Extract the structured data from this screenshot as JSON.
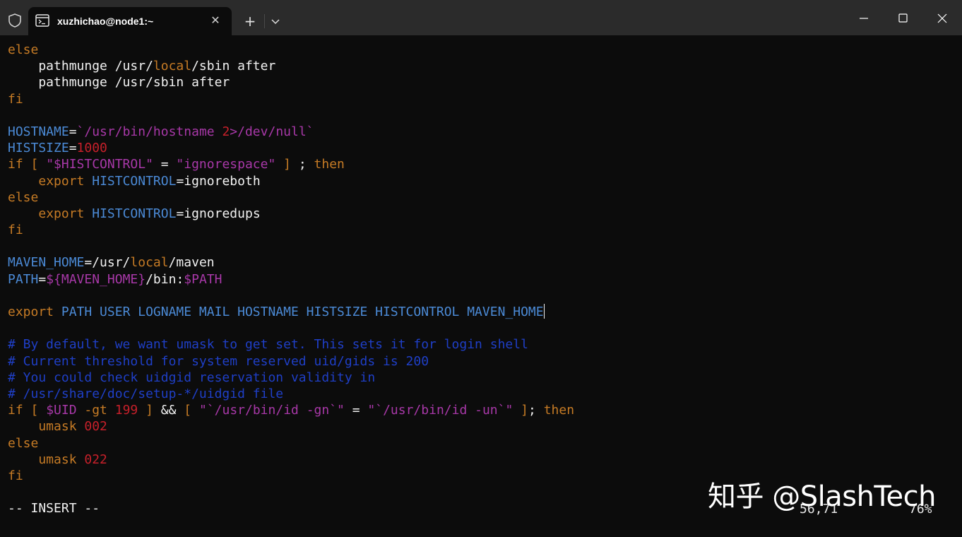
{
  "colors": {
    "keyword": "#c67b25",
    "variable": "#4b8ad6",
    "string": "#a838a8",
    "number": "#c7202a",
    "comment": "#1f3fc7",
    "plain": "#f2f2f2",
    "background": "#0c0c0c",
    "titlebar": "#2b2b2b"
  },
  "window": {
    "tab_title": "xuzhichao@node1:~",
    "tab_icon": "terminal-icon",
    "new_tab_label": "+",
    "close_tab_label": "✕"
  },
  "editor": {
    "lines": [
      [
        {
          "t": "else",
          "c": "keyword"
        }
      ],
      [
        {
          "t": "    pathmunge /usr/",
          "c": "plain"
        },
        {
          "t": "local",
          "c": "keyword"
        },
        {
          "t": "/sbin after",
          "c": "plain"
        }
      ],
      [
        {
          "t": "    pathmunge /usr/sbin after",
          "c": "plain"
        }
      ],
      [
        {
          "t": "fi",
          "c": "keyword"
        }
      ],
      [],
      [
        {
          "t": "HOSTNAME",
          "c": "variable"
        },
        {
          "t": "=",
          "c": "plain"
        },
        {
          "t": "`/usr/bin/hostname ",
          "c": "string"
        },
        {
          "t": "2",
          "c": "number"
        },
        {
          "t": ">/dev/null`",
          "c": "string"
        }
      ],
      [
        {
          "t": "HISTSIZE",
          "c": "variable"
        },
        {
          "t": "=",
          "c": "plain"
        },
        {
          "t": "1000",
          "c": "number"
        }
      ],
      [
        {
          "t": "if [ ",
          "c": "keyword"
        },
        {
          "t": "\"$HISTCONTROL\"",
          "c": "string"
        },
        {
          "t": " = ",
          "c": "plain"
        },
        {
          "t": "\"ignorespace\"",
          "c": "string"
        },
        {
          "t": " ]",
          "c": "keyword"
        },
        {
          "t": " ; ",
          "c": "plain"
        },
        {
          "t": "then",
          "c": "keyword"
        }
      ],
      [
        {
          "t": "    ",
          "c": "plain"
        },
        {
          "t": "export",
          "c": "keyword"
        },
        {
          "t": " ",
          "c": "plain"
        },
        {
          "t": "HISTCONTROL",
          "c": "variable"
        },
        {
          "t": "=ignoreboth",
          "c": "plain"
        }
      ],
      [
        {
          "t": "else",
          "c": "keyword"
        }
      ],
      [
        {
          "t": "    ",
          "c": "plain"
        },
        {
          "t": "export",
          "c": "keyword"
        },
        {
          "t": " ",
          "c": "plain"
        },
        {
          "t": "HISTCONTROL",
          "c": "variable"
        },
        {
          "t": "=ignoredups",
          "c": "plain"
        }
      ],
      [
        {
          "t": "fi",
          "c": "keyword"
        }
      ],
      [],
      [
        {
          "t": "MAVEN_HOME",
          "c": "variable"
        },
        {
          "t": "=/usr/",
          "c": "plain"
        },
        {
          "t": "local",
          "c": "keyword"
        },
        {
          "t": "/maven",
          "c": "plain"
        }
      ],
      [
        {
          "t": "PATH",
          "c": "variable"
        },
        {
          "t": "=",
          "c": "plain"
        },
        {
          "t": "${MAVEN_HOME}",
          "c": "string"
        },
        {
          "t": "/bin:",
          "c": "plain"
        },
        {
          "t": "$PATH",
          "c": "string"
        }
      ],
      [],
      [
        {
          "t": "export",
          "c": "keyword"
        },
        {
          "t": " PATH USER LOGNAME MAIL HOSTNAME HISTSIZE HISTCONTROL MAVEN_HOME",
          "c": "variable"
        },
        {
          "cursor": true
        }
      ],
      [],
      [
        {
          "t": "# By default, we want umask to get set. This sets it for login shell",
          "c": "comment"
        }
      ],
      [
        {
          "t": "# Current threshold for system reserved uid/gids is 200",
          "c": "comment"
        }
      ],
      [
        {
          "t": "# You could check uidgid reservation validity in",
          "c": "comment"
        }
      ],
      [
        {
          "t": "# /usr/share/doc/setup-*/uidgid file",
          "c": "comment"
        }
      ],
      [
        {
          "t": "if [ ",
          "c": "keyword"
        },
        {
          "t": "$UID",
          "c": "string"
        },
        {
          "t": " -gt ",
          "c": "keyword"
        },
        {
          "t": "199",
          "c": "number"
        },
        {
          "t": " ]",
          "c": "keyword"
        },
        {
          "t": " && ",
          "c": "plain"
        },
        {
          "t": "[ ",
          "c": "keyword"
        },
        {
          "t": "\"`/usr/bin/id -gn`\"",
          "c": "string"
        },
        {
          "t": " = ",
          "c": "plain"
        },
        {
          "t": "\"`/usr/bin/id -un`\"",
          "c": "string"
        },
        {
          "t": " ]",
          "c": "keyword"
        },
        {
          "t": "; ",
          "c": "plain"
        },
        {
          "t": "then",
          "c": "keyword"
        }
      ],
      [
        {
          "t": "    umask ",
          "c": "keyword"
        },
        {
          "t": "002",
          "c": "number"
        }
      ],
      [
        {
          "t": "else",
          "c": "keyword"
        }
      ],
      [
        {
          "t": "    umask ",
          "c": "keyword"
        },
        {
          "t": "022",
          "c": "number"
        }
      ],
      [
        {
          "t": "fi",
          "c": "keyword"
        }
      ],
      [],
      [
        {
          "t": "-- INSERT --",
          "c": "plain"
        }
      ]
    ]
  },
  "status": {
    "mode": "-- INSERT --",
    "cursor_position": "56,71",
    "scroll_percent": "76%"
  },
  "watermark": {
    "text": "知乎 @SlashTech"
  }
}
